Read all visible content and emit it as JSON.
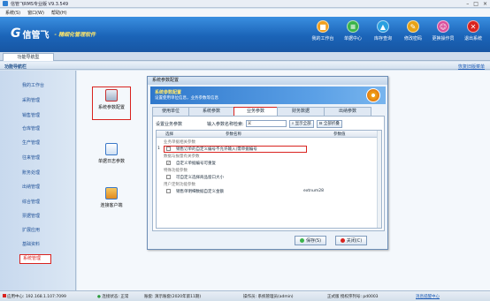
{
  "window": {
    "title": "信管飞RMS专业版 V9.3.549"
  },
  "menu": [
    "系统(S)",
    "窗口(W)",
    "帮助(H)"
  ],
  "brand": {
    "mark": "G",
    "name": "信管飞",
    "slogan": "- 精细化管理软件"
  },
  "toolbar": [
    {
      "label": "我的工作台",
      "color": "#f0a020",
      "glyph": "■"
    },
    {
      "label": "单据中心",
      "color": "#3cb44b",
      "glyph": "≡"
    },
    {
      "label": "库存查询",
      "color": "#2aa0e0",
      "glyph": "▲"
    },
    {
      "label": "修改密码",
      "color": "#e8a317",
      "glyph": "✎"
    },
    {
      "label": "更换操作员",
      "color": "#d94f9c",
      "glyph": "☺"
    },
    {
      "label": "退出系统",
      "color": "#d9231f",
      "glyph": "✕"
    }
  ],
  "tab": "功能导航型",
  "nav": {
    "title": "功能导航栏",
    "restore_link": "恢复旧版菜单"
  },
  "sidebar": [
    "我的工作台",
    "采购管理",
    "销售管理",
    "仓库管理",
    "生产管理",
    "往来管理",
    "账务处理",
    "出纳管理",
    "综合管理",
    "票据管理",
    "扩展应用",
    "基础资料",
    "系统管理"
  ],
  "sidebar_active": "系统管理",
  "feature_icons": [
    {
      "label": "系统参数配置",
      "color": "#c83030"
    },
    {
      "label": "单据日志参数",
      "color": "#3a78c8"
    },
    {
      "label": "连接客户端",
      "color": "#e8a020"
    }
  ],
  "dialog": {
    "title": "系统参数配置",
    "header_title": "系统参数配置",
    "header_sub": "设置使用单位信息，业务参数等信息",
    "tabs": [
      "使用单位",
      "系统参数",
      "业务参数",
      "财务数据",
      "出纳参数"
    ],
    "active_tab": "业务参数",
    "search_label": "设置业务参数",
    "search_input_label": "输入参数名称检索:",
    "search_value": "义",
    "show_all": "显示全部",
    "collapse_all": "全部折叠",
    "columns": [
      "选择",
      "参数名称",
      "参数值"
    ],
    "rows": [
      {
        "type": "group",
        "name": "业务单据相关参数"
      },
      {
        "type": "item",
        "row": "1",
        "checked": false,
        "name": "销售订单的自定义编号不允许输入(需单据编号",
        "value": "",
        "highlight": true
      },
      {
        "type": "group",
        "name": "数据与报量有关参数"
      },
      {
        "type": "item",
        "row": "",
        "checked": true,
        "name": "自定义单据编号可重复",
        "value": ""
      },
      {
        "type": "group",
        "name": "特殊功能参数"
      },
      {
        "type": "item",
        "row": "",
        "checked": false,
        "name": "可自定义选择商品窗口大小",
        "value": ""
      },
      {
        "type": "group",
        "name": "用户定制功能参数"
      },
      {
        "type": "item",
        "row": "",
        "checked": false,
        "name": "销售单明细数据自定义金额",
        "value": "extnum28"
      }
    ],
    "save": "保存(S)",
    "close": "关闭(C)"
  },
  "status": {
    "center": "应用中心: 192.168.1.107:7099",
    "conn": "连接状态: 正常",
    "account": "账套: 演示账套(2020年第11期)",
    "operator": "操作员: 系统管理员(admin)",
    "license": "正式版 授权序列号: pd0003",
    "message": "消息提醒中心"
  }
}
